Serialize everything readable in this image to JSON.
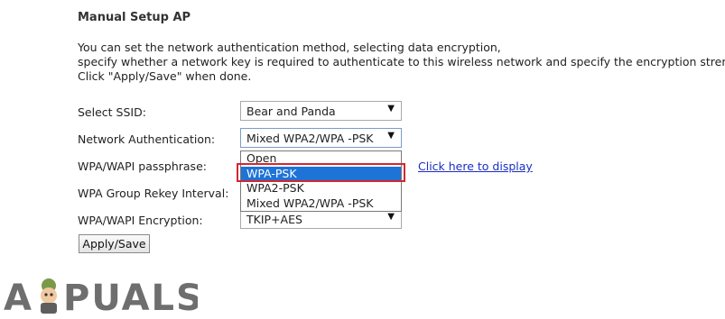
{
  "section_title": "Manual Setup AP",
  "description": {
    "line1": "You can set the network authentication method, selecting data encryption,",
    "line2": "specify whether a network key is required to authenticate to this wireless network and specify the encryption strength.",
    "line3": "Click \"Apply/Save\" when done."
  },
  "fields": {
    "ssid": {
      "label": "Select SSID:",
      "value": "Bear and Panda"
    },
    "auth": {
      "label": "Network Authentication:",
      "value": "Mixed WPA2/WPA -PSK"
    },
    "passphrase": {
      "label": "WPA/WAPI passphrase:",
      "link": "Click here to display"
    },
    "rekey": {
      "label": "WPA Group Rekey Interval:"
    },
    "encryption": {
      "label": "WPA/WAPI Encryption:",
      "value": "TKIP+AES"
    }
  },
  "auth_dropdown": {
    "options": [
      "Open",
      "WPA-PSK",
      "WPA2-PSK",
      "Mixed WPA2/WPA -PSK"
    ],
    "highlighted": "WPA-PSK"
  },
  "apply_button": "Apply/Save",
  "watermark": "APPUALS",
  "colors": {
    "highlight_box": "#d2282e",
    "selected_option": "#1e73d6",
    "link": "#1a2ec2"
  }
}
